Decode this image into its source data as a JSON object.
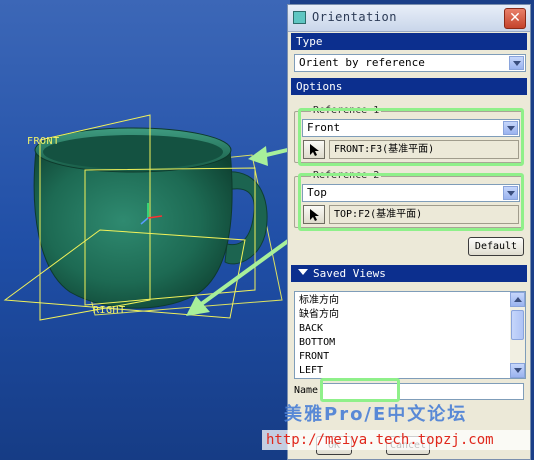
{
  "viewport": {
    "labels": {
      "front": "FRONT",
      "right": "RIGHT"
    }
  },
  "dialog": {
    "title": "Orientation",
    "close_icon": "close-icon",
    "type_section": "Type",
    "type_value": "Orient by reference",
    "options_section": "Options",
    "reference1": {
      "label": "Reference 1",
      "value": "Front",
      "selection": "FRONT:F3(基准平面)"
    },
    "reference2": {
      "label": "Reference 2",
      "value": "Top",
      "selection": "TOP:F2(基准平面)"
    },
    "default_button": "Default",
    "saved_views_section": "Saved Views",
    "saved_views": [
      "标准方向",
      "缺省方向",
      "BACK",
      "BOTTOM",
      "FRONT",
      "LEFT"
    ],
    "name_label": "Name",
    "name_value": "",
    "ok_button": "OK",
    "cancel_button": "Cancel"
  },
  "watermark": {
    "line1": "美雅Pro/E中文论坛",
    "line2": "http://meiya.tech.topzj.com"
  },
  "colors": {
    "viewport_bg": "#2352a8",
    "section_header": "#0c2f8e",
    "highlight": "#8ff08a",
    "cup": "#1f6a55",
    "datum_plane": "#f2f25a",
    "watermark_blue": "#4a7fd6",
    "watermark_red": "#e0281c"
  }
}
